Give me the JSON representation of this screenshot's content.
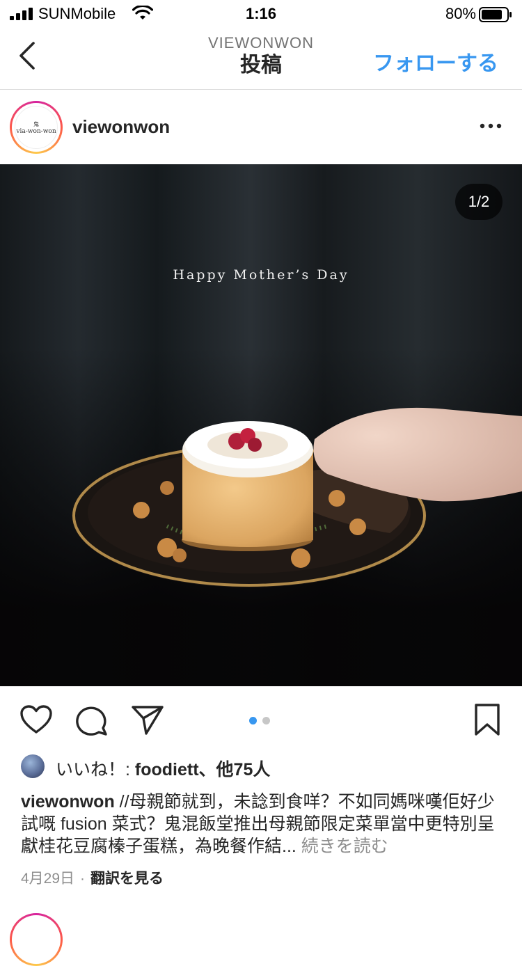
{
  "status": {
    "carrier": "SUNMobile",
    "time": "1:16",
    "battery_pct": "80%"
  },
  "nav": {
    "subtitle": "VIEWONWON",
    "title": "投稿",
    "follow_label": "フォローする"
  },
  "post": {
    "username": "viewonwon",
    "avatar_text_line1": "鬼",
    "avatar_text_line2": "via-won-won",
    "photo_counter": "1/2",
    "photo_overlay_text": "Happy Mother’s Day",
    "carousel_pages": 2,
    "carousel_current": 1
  },
  "likes": {
    "prefix": "いいね！: ",
    "users": "foodiett、他75人"
  },
  "caption": {
    "username": "viewonwon",
    "text": " //母親節就到，未諗到食咩？不如同媽咪嘆佢好少試嘅 fusion 菜式？鬼混飯堂推出母親節限定菜單當中更特別呈獻桂花豆腐榛子蛋糕，為晚餐作結...",
    "more_label": " 続きを読む"
  },
  "meta": {
    "date": "4月29日",
    "separator": "·",
    "translate_label": "翻訳を見る"
  },
  "colors": {
    "accent": "#3897f0",
    "text": "#262626",
    "secondary": "#8e8e8e"
  }
}
